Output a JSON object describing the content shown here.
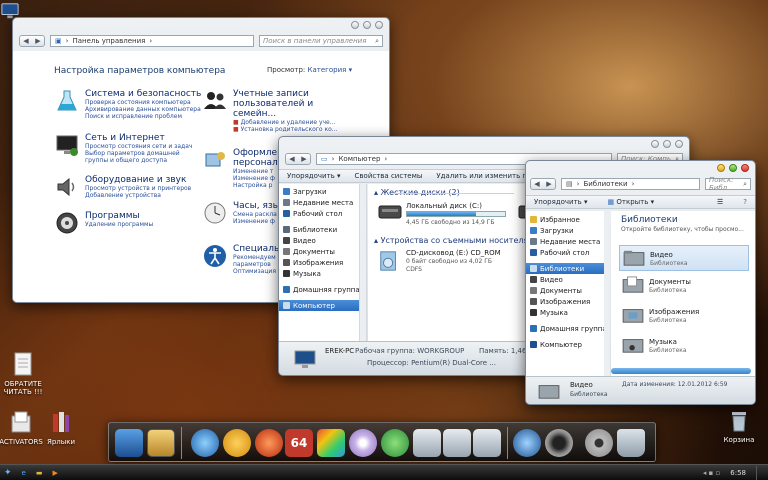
{
  "desktop": {
    "icons": [
      {
        "label": "Компьютер"
      },
      {
        "label": "ОБРАТИТЕ ЧИТАТЬ !!!"
      },
      {
        "label": "ACTIVATORS"
      },
      {
        "label": "Ярлыки"
      },
      {
        "label": "Корзина"
      }
    ]
  },
  "control_panel": {
    "address": "Панель управления",
    "search_placeholder": "Поиск в панели управления",
    "heading": "Настройка параметров компьютера",
    "view_label": "Просмотр:",
    "view_value": "Категория",
    "left_items": [
      {
        "title": "Система и безопасность",
        "subs": [
          "Проверка состояния компьютера",
          "Архивирование данных компьютера",
          "Поиск и исправление проблем"
        ]
      },
      {
        "title": "Сеть и Интернет",
        "subs": [
          "Просмотр состояния сети и задач",
          "Выбор параметров домашней",
          "группы и общего доступа"
        ]
      },
      {
        "title": "Оборудование и звук",
        "subs": [
          "Просмотр устройств и принтеров",
          "Добавление устройства"
        ]
      },
      {
        "title": "Программы",
        "subs": [
          "Удаление программы"
        ]
      }
    ],
    "right_items": [
      {
        "title": "Учетные записи пользователей и семейн...",
        "subs": [
          "Добавление и удаление уче...",
          "Установка родительского ко..."
        ]
      },
      {
        "title": "Оформле персонал",
        "subs": [
          "Изменение т",
          "Изменение ф",
          "Настройка р"
        ]
      },
      {
        "title": "Часы, язы",
        "subs": [
          "Смена раскла",
          "Изменение ф"
        ]
      },
      {
        "title": "Специальн",
        "subs": [
          "Рекомендуем",
          "параметров",
          "Оптимизация"
        ]
      }
    ]
  },
  "computer": {
    "address": "Компьютер",
    "search_placeholder": "Поиск: Компь",
    "toolbar": [
      "Упорядочить ▾",
      "Свойства системы",
      "Удалить или изменить программу"
    ],
    "nav": [
      {
        "label": "Загрузки",
        "group": false
      },
      {
        "label": "Недавние места",
        "group": false
      },
      {
        "label": "Рабочий стол",
        "group": false
      },
      {
        "label": "Библиотеки",
        "group": true
      },
      {
        "label": "Видео",
        "group": false
      },
      {
        "label": "Документы",
        "group": false
      },
      {
        "label": "Изображения",
        "group": false
      },
      {
        "label": "Музыка",
        "group": false
      },
      {
        "label": "Домашняя группа",
        "group": true
      },
      {
        "label": "Компьютер",
        "group": true
      }
    ],
    "hdd_header": "Жесткие диски (2)",
    "disk_name": "Локальный диск (C:)",
    "disk_free": "4,45 ГБ свободно из 14,9 ГБ",
    "disk_used_fraction": 0.7,
    "removable_header": "Устройства со съемными носителями (",
    "cd_name": "CD-дисковод (E:) CD_ROM",
    "cd_free": "0 байт свободно из 4,02 ГБ",
    "cd_fs": "CDFS",
    "pc_name": "EREK-PC",
    "workgroup_label": "Рабочая группа: WORKGROUP",
    "memory_label": "Память: 1,46 ГБ",
    "processor_label": "Процессор: Pentium(R) Dual-Core ..."
  },
  "libraries": {
    "address": "Библиотеки",
    "search_placeholder": "Поиск: Библ",
    "toolbar": [
      "Упорядочить ▾",
      "Открыть ▾"
    ],
    "nav": [
      {
        "label": "Избранное",
        "group": false
      },
      {
        "label": "Загрузки",
        "group": false
      },
      {
        "label": "Недавние места",
        "group": false
      },
      {
        "label": "Рабочий стол",
        "group": false
      },
      {
        "label": "Библиотеки",
        "group": true
      },
      {
        "label": "Видео",
        "group": false
      },
      {
        "label": "Документы",
        "group": false
      },
      {
        "label": "Изображения",
        "group": false
      },
      {
        "label": "Музыка",
        "group": false
      },
      {
        "label": "Домашняя группа",
        "group": true
      },
      {
        "label": "Компьютер",
        "group": true
      }
    ],
    "heading": "Библиотеки",
    "subheading": "Откройте библиотеку, чтобы просмо...",
    "items": [
      {
        "name": "Видео",
        "type": "Библиотека"
      },
      {
        "name": "Документы",
        "type": "Библиотека"
      },
      {
        "name": "Изображения",
        "type": "Библиотека"
      },
      {
        "name": "Музыка",
        "type": "Библиотека"
      }
    ],
    "details_name": "Видео",
    "details_type": "Библиотека",
    "details_date": "Дата изменения: 12.01.2012 6:59"
  },
  "taskbar": {
    "clock": "6:58"
  },
  "colors": {
    "accent": "#2b6cc0",
    "link": "#2a4f9a",
    "title_link": "#0b2a6e"
  }
}
